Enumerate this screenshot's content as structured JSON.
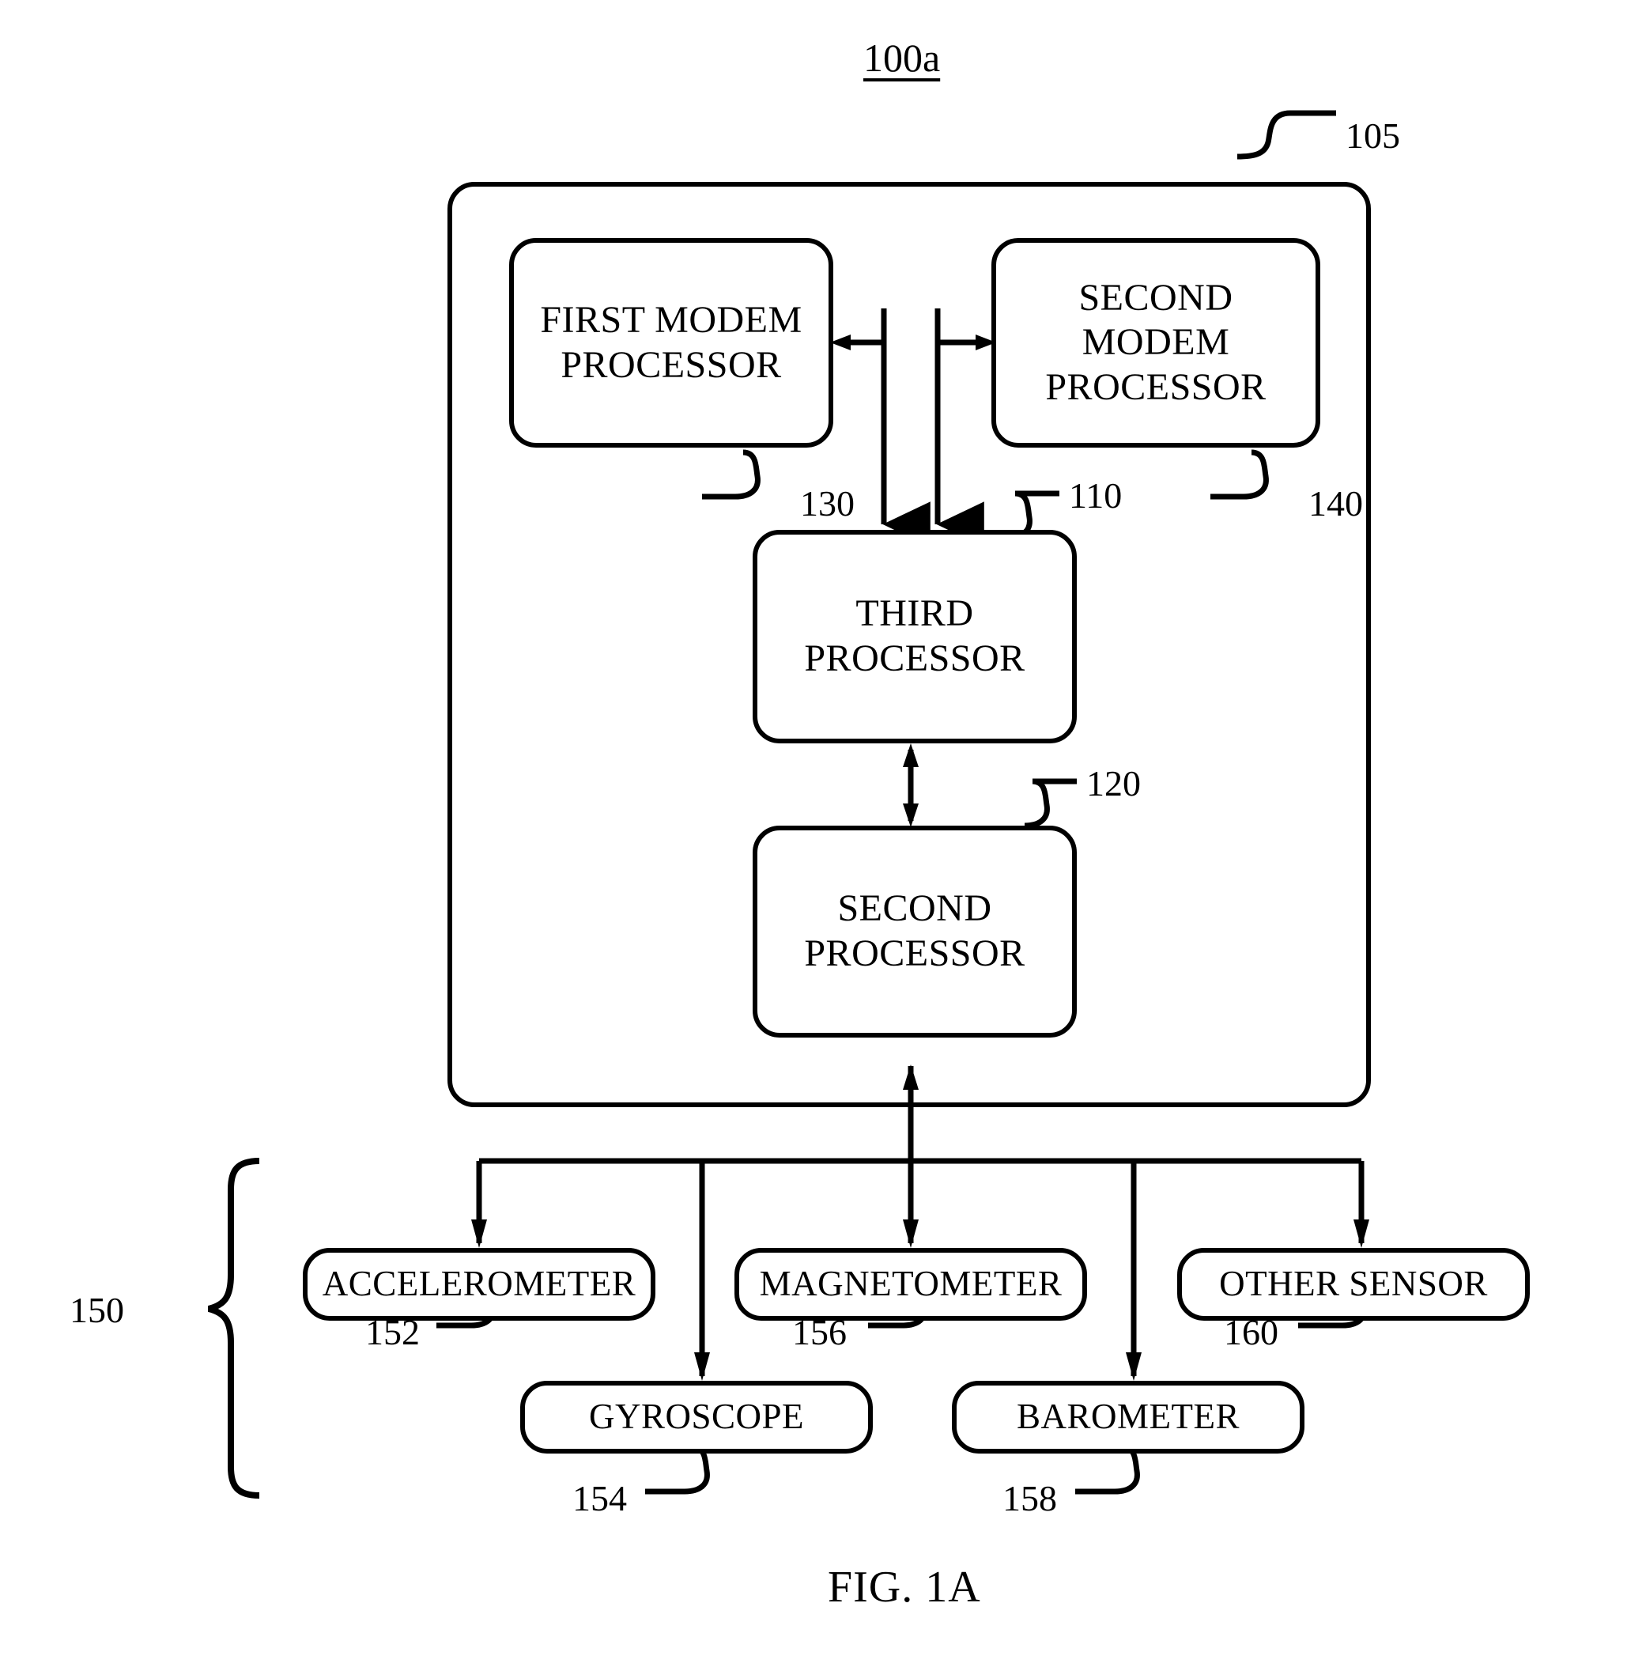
{
  "figure": {
    "title": "100a",
    "caption": "FIG. 1A"
  },
  "chip": {
    "ref": "105"
  },
  "nodes": {
    "first_modem_processor": {
      "label": "FIRST MODEM\nPROCESSOR",
      "ref": "130"
    },
    "second_modem_processor": {
      "label": "SECOND MODEM\nPROCESSOR",
      "ref": "140"
    },
    "third_processor": {
      "label": "THIRD\nPROCESSOR",
      "ref": "110"
    },
    "second_processor": {
      "label": "SECOND\nPROCESSOR",
      "ref": "120"
    }
  },
  "sensor_group": {
    "ref": "150",
    "sensors": [
      {
        "label": "ACCELEROMETER",
        "ref": "152"
      },
      {
        "label": "MAGNETOMETER",
        "ref": "156"
      },
      {
        "label": "OTHER SENSOR",
        "ref": "160"
      },
      {
        "label": "GYROSCOPE",
        "ref": "154"
      },
      {
        "label": "BAROMETER",
        "ref": "158"
      }
    ]
  },
  "colors": {
    "stroke": "#000000",
    "background": "#ffffff"
  }
}
